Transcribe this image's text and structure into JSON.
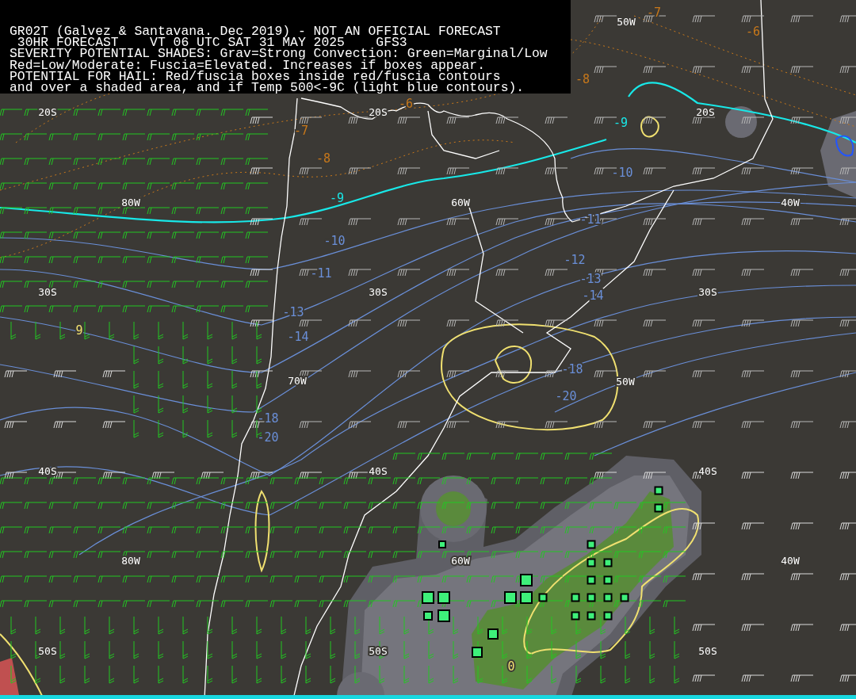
{
  "header": {
    "lines": [
      "GR02T (Galvez & Santavana. Dec 2019) - NOT AN OFFICIAL FORECAST",
      " 30HR FORECAST    VT 06 UTC SAT 31 MAY 2025    GFS3",
      "SEVERITY POTENTIAL SHADES: Grav=Strong Convection: Green=Marginal/Low",
      "Red=Low/Moderate: Fuscia=Elevated. Increases if boxes appear.",
      "POTENTIAL FOR HAIL: Red/fuscia boxes inside red/fuscia contours",
      "and over a shaded area, and if Temp 500<-9C (light blue contours)."
    ]
  },
  "map": {
    "grid_labels": [
      {
        "text": "50W"
      },
      {
        "text": "20S"
      },
      {
        "text": "20S"
      },
      {
        "text": "20S"
      },
      {
        "text": "80W"
      },
      {
        "text": "60W"
      },
      {
        "text": "40W"
      },
      {
        "text": "30S"
      },
      {
        "text": "30S"
      },
      {
        "text": "30S"
      },
      {
        "text": "70W"
      },
      {
        "text": "50W"
      },
      {
        "text": "40S"
      },
      {
        "text": "40S"
      },
      {
        "text": "40S"
      },
      {
        "text": "80W"
      },
      {
        "text": "60W"
      },
      {
        "text": "40W"
      },
      {
        "text": "50S"
      },
      {
        "text": "50S"
      },
      {
        "text": "50S"
      }
    ],
    "contour_labels": [
      {
        "text": "-7",
        "color": "#c8781a"
      },
      {
        "text": "-6",
        "color": "#c8781a"
      },
      {
        "text": "-8",
        "color": "#c8781a"
      },
      {
        "text": "-6",
        "color": "#c8781a"
      },
      {
        "text": "-7",
        "color": "#c8781a"
      },
      {
        "text": "-8",
        "color": "#c8781a"
      },
      {
        "text": "-9",
        "color": "#18e8e8"
      },
      {
        "text": "-9",
        "color": "#18e8e8"
      },
      {
        "text": "-10",
        "color": "#6a8fd8"
      },
      {
        "text": "-10",
        "color": "#6a8fd8"
      },
      {
        "text": "-11",
        "color": "#6a8fd8"
      },
      {
        "text": "-11",
        "color": "#6a8fd8"
      },
      {
        "text": "-12",
        "color": "#6a8fd8"
      },
      {
        "text": "-13",
        "color": "#6a8fd8"
      },
      {
        "text": "-13",
        "color": "#6a8fd8"
      },
      {
        "text": "-14",
        "color": "#6a8fd8"
      },
      {
        "text": "-14",
        "color": "#6a8fd8"
      },
      {
        "text": "-18",
        "color": "#6a8fd8"
      },
      {
        "text": "-20",
        "color": "#6a8fd8"
      },
      {
        "text": "-18",
        "color": "#6a8fd8"
      },
      {
        "text": "-20",
        "color": "#6a8fd8"
      },
      {
        "text": "0",
        "color": "#f0e070"
      },
      {
        "text": "9",
        "color": "#f0e070"
      }
    ]
  }
}
